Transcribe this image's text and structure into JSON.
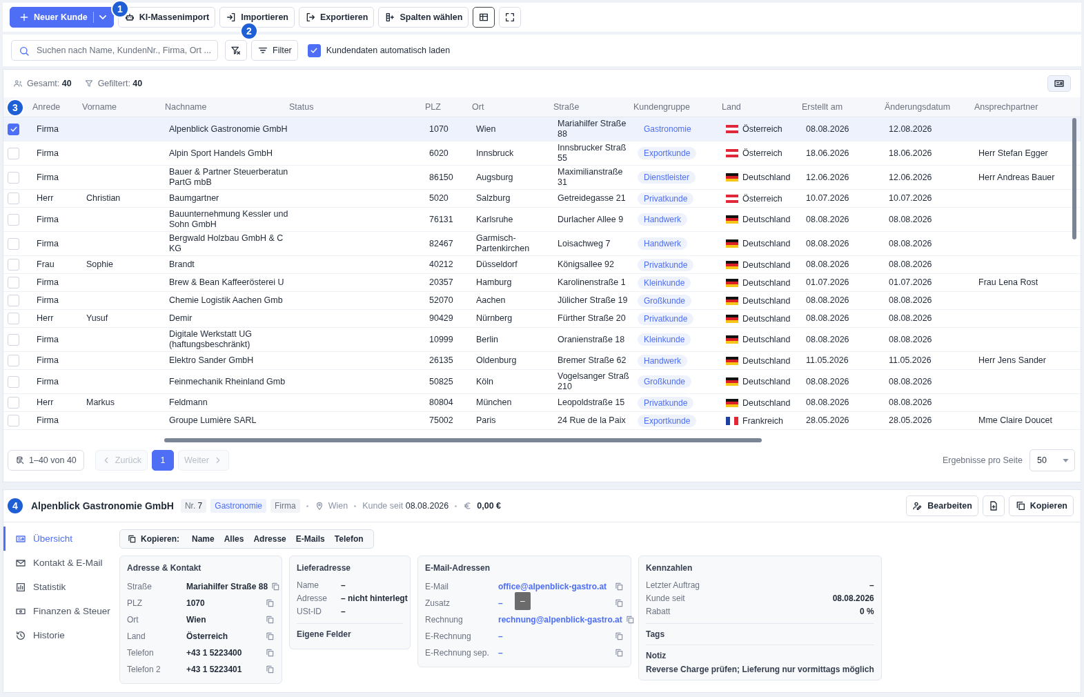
{
  "toolbar": {
    "new_button": "Neuer Kunde",
    "buttons": [
      "KI-Massenimport",
      "Importieren",
      "Exportieren",
      "Spalten wählen"
    ]
  },
  "markers": [
    "1",
    "2",
    "3",
    "4"
  ],
  "search": {
    "placeholder": "Suchen nach Name, KundenNr., Firma, Ort ...",
    "filter_button": "Filter",
    "autoload": {
      "label": "Kundendaten automatisch laden",
      "checked": true
    }
  },
  "summary": {
    "total_label": "Gesamt:",
    "total": "40",
    "filtered_label": "Gefiltert:",
    "filtered": "40"
  },
  "table": {
    "columns": [
      "Anrede",
      "Vorname",
      "Nachname",
      "Status",
      "PLZ",
      "Ort",
      "Straße",
      "Kundengruppe",
      "Land",
      "Erstellt am",
      "Änderungsdatum",
      "Ansprechpartner"
    ],
    "rows": [
      {
        "selected": true,
        "anrede": "Firma",
        "vorname": "",
        "nachname": "Alpenblick Gastronomie GmbH",
        "plz": "1070",
        "ort": "Wien",
        "strasse": "Mariahilfer Straße\n88",
        "gruppe": "Gastronomie",
        "flag": {
          "kind": "at"
        },
        "land": "Österreich",
        "erstellt": "08.08.2026",
        "geaendert": "12.08.2026",
        "ansprech": ""
      },
      {
        "selected": false,
        "anrede": "Firma",
        "vorname": "",
        "nachname": "Alpin Sport Handels GmbH",
        "plz": "6020",
        "ort": "Innsbruck",
        "strasse": "Innsbrucker Straß\n55",
        "gruppe": "Exportkunde",
        "flag": {
          "kind": "at"
        },
        "land": "Österreich",
        "erstellt": "18.06.2026",
        "geaendert": "18.06.2026",
        "ansprech": "Herr Stefan Egger"
      },
      {
        "selected": false,
        "anrede": "Firma",
        "vorname": "",
        "nachname": "Bauer & Partner Steuerberatun\nPartG mbB",
        "plz": "86150",
        "ort": "Augsburg",
        "strasse": "Maximilianstraße\n31",
        "gruppe": "Dienstleister",
        "flag": {
          "kind": "de"
        },
        "land": "Deutschland",
        "erstellt": "12.06.2026",
        "geaendert": "12.06.2026",
        "ansprech": "Herr Andreas Bauer"
      },
      {
        "selected": false,
        "anrede": "Herr",
        "vorname": "Christian",
        "nachname": "Baumgartner",
        "plz": "5020",
        "ort": "Salzburg",
        "strasse": "Getreidegasse 21",
        "gruppe": "Privatkunde",
        "flag": {
          "kind": "at"
        },
        "land": "Österreich",
        "erstellt": "10.07.2026",
        "geaendert": "10.07.2026",
        "ansprech": ""
      },
      {
        "selected": false,
        "anrede": "Firma",
        "vorname": "",
        "nachname": "Bauunternehmung Kessler und\nSohn GmbH",
        "plz": "76131",
        "ort": "Karlsruhe",
        "strasse": "Durlacher Allee 9",
        "gruppe": "Handwerk",
        "flag": {
          "kind": "de"
        },
        "land": "Deutschland",
        "erstellt": "08.08.2026",
        "geaendert": "08.08.2026",
        "ansprech": ""
      },
      {
        "selected": false,
        "anrede": "Firma",
        "vorname": "",
        "nachname": "Bergwald Holzbau GmbH & C\nKG",
        "plz": "82467",
        "ort": "Garmisch-\nPartenkirchen",
        "strasse": "Loisachweg 7",
        "gruppe": "Handwerk",
        "flag": {
          "kind": "de"
        },
        "land": "Deutschland",
        "erstellt": "08.08.2026",
        "geaendert": "08.08.2026",
        "ansprech": ""
      },
      {
        "selected": false,
        "anrede": "Frau",
        "vorname": "Sophie",
        "nachname": "Brandt",
        "plz": "40212",
        "ort": "Düsseldorf",
        "strasse": "Königsallee 92",
        "gruppe": "Privatkunde",
        "flag": {
          "kind": "de"
        },
        "land": "Deutschland",
        "erstellt": "08.08.2026",
        "geaendert": "08.08.2026",
        "ansprech": ""
      },
      {
        "selected": false,
        "anrede": "Firma",
        "vorname": "",
        "nachname": "Brew & Bean Kaffeerösterei U",
        "plz": "20357",
        "ort": "Hamburg",
        "strasse": "Karolinenstraße 1",
        "gruppe": "Kleinkunde",
        "flag": {
          "kind": "de"
        },
        "land": "Deutschland",
        "erstellt": "01.07.2026",
        "geaendert": "01.07.2026",
        "ansprech": "Frau Lena Rost"
      },
      {
        "selected": false,
        "anrede": "Firma",
        "vorname": "",
        "nachname": "Chemie Logistik Aachen Gmb",
        "plz": "52070",
        "ort": "Aachen",
        "strasse": "Jülicher Straße 19",
        "gruppe": "Großkunde",
        "flag": {
          "kind": "de"
        },
        "land": "Deutschland",
        "erstellt": "08.08.2026",
        "geaendert": "08.08.2026",
        "ansprech": ""
      },
      {
        "selected": false,
        "anrede": "Herr",
        "vorname": "Yusuf",
        "nachname": "Demir",
        "plz": "90429",
        "ort": "Nürnberg",
        "strasse": "Fürther Straße 20",
        "gruppe": "Privatkunde",
        "flag": {
          "kind": "de"
        },
        "land": "Deutschland",
        "erstellt": "08.08.2026",
        "geaendert": "08.08.2026",
        "ansprech": ""
      },
      {
        "selected": false,
        "anrede": "Firma",
        "vorname": "",
        "nachname": "Digitale Werkstatt UG\n(haftungsbeschränkt)",
        "plz": "10999",
        "ort": "Berlin",
        "strasse": "Oranienstraße 18",
        "gruppe": "Kleinkunde",
        "flag": {
          "kind": "de"
        },
        "land": "Deutschland",
        "erstellt": "08.08.2026",
        "geaendert": "08.08.2026",
        "ansprech": ""
      },
      {
        "selected": false,
        "anrede": "Firma",
        "vorname": "",
        "nachname": "Elektro Sander GmbH",
        "plz": "26135",
        "ort": "Oldenburg",
        "strasse": "Bremer Straße 62",
        "gruppe": "Handwerk",
        "flag": {
          "kind": "de"
        },
        "land": "Deutschland",
        "erstellt": "11.05.2026",
        "geaendert": "11.05.2026",
        "ansprech": "Herr Jens Sander"
      },
      {
        "selected": false,
        "anrede": "Firma",
        "vorname": "",
        "nachname": "Feinmechanik Rheinland Gmb",
        "plz": "50825",
        "ort": "Köln",
        "strasse": "Vogelsanger Straß\n210",
        "gruppe": "Großkunde",
        "flag": {
          "kind": "de"
        },
        "land": "Deutschland",
        "erstellt": "08.08.2026",
        "geaendert": "08.08.2026",
        "ansprech": ""
      },
      {
        "selected": false,
        "anrede": "Herr",
        "vorname": "Markus",
        "nachname": "Feldmann",
        "plz": "80804",
        "ort": "München",
        "strasse": "Leopoldstraße 15",
        "gruppe": "Privatkunde",
        "flag": {
          "kind": "de"
        },
        "land": "Deutschland",
        "erstellt": "08.08.2026",
        "geaendert": "08.08.2026",
        "ansprech": ""
      },
      {
        "selected": false,
        "anrede": "Firma",
        "vorname": "",
        "nachname": "Groupe Lumière SARL",
        "plz": "75002",
        "ort": "Paris",
        "strasse": "24 Rue de la Paix",
        "gruppe": "Exportkunde",
        "flag": {
          "kind": "fr"
        },
        "land": "Frankreich",
        "erstellt": "28.05.2026",
        "geaendert": "28.05.2026",
        "ansprech": "Mme Claire Doucet"
      }
    ]
  },
  "pagination": {
    "range": "1–40 von 40",
    "prev": {
      "label": "Zurück",
      "disabled": true
    },
    "pages": [
      {
        "label": "1",
        "selected": true
      }
    ],
    "next": {
      "label": "Weiter",
      "disabled": true
    },
    "per_page_label": "Ergebnisse pro Seite",
    "per_page": "50"
  },
  "detail": {
    "title": "Alpenblick Gastronomie GmbH",
    "nr_label": "Nr.",
    "nr": "7",
    "group": "Gastronomie",
    "type": "Firma",
    "city": "Wien",
    "since_label": "Kunde seit",
    "since": "08.08.2026",
    "revenue": "0,00 €",
    "actions": [
      "Bearbeiten",
      "Kopieren"
    ],
    "nav": [
      {
        "label": "Übersicht",
        "selected": true
      },
      {
        "label": "Kontakt & E-Mail",
        "selected": false
      },
      {
        "label": "Statistik",
        "selected": false
      },
      {
        "label": "Finanzen & Steuer",
        "selected": false
      },
      {
        "label": "Historie",
        "selected": false
      }
    ],
    "copy_bar": {
      "label": "Kopieren:",
      "items": [
        "Name",
        "Alles",
        "Adresse",
        "E-Mails",
        "Telefon"
      ]
    },
    "address": {
      "title": "Adresse & Kontakt",
      "rows": [
        {
          "label": "Straße",
          "value": "Mariahilfer Straße 88"
        },
        {
          "label": "PLZ",
          "value": "1070"
        },
        {
          "label": "Ort",
          "value": "Wien"
        },
        {
          "label": "Land",
          "value": "Österreich"
        },
        {
          "label": "Telefon",
          "value": "+43 1 5223400"
        },
        {
          "label": "Telefon 2",
          "value": "+43 1 5223401"
        }
      ]
    },
    "delivery": {
      "title": "Lieferadresse",
      "rows": [
        {
          "label": "Name",
          "value": "–"
        },
        {
          "label": "Adresse",
          "value": "– nicht hinterlegt"
        },
        {
          "label": "USt-ID",
          "value": "–"
        }
      ],
      "custom_fields": "Eigene Felder"
    },
    "emails": {
      "title": "E-Mail-Adressen",
      "rows": [
        {
          "label": "E-Mail",
          "value": "office@alpenblick-gastro.at"
        },
        {
          "label": "Zusatz",
          "value": "–"
        },
        {
          "label": "Rechnung",
          "value": "rechnung@alpenblick-gastro.at"
        },
        {
          "label": "E-Rechnung",
          "value": "–"
        },
        {
          "label": "E-Rechnung sep.",
          "value": "–"
        }
      ],
      "tooltip": "–"
    },
    "metrics": {
      "title": "Kennzahlen",
      "rows": [
        {
          "label": "Letzter Auftrag",
          "value": "–"
        },
        {
          "label": "Kunde seit",
          "value": "08.08.2026"
        },
        {
          "label": "Rabatt",
          "value": "0 %"
        }
      ],
      "tags_label": "Tags",
      "note_label": "Notiz",
      "note": "Reverse Charge prüfen; Lieferung nur vormittags möglich"
    }
  }
}
